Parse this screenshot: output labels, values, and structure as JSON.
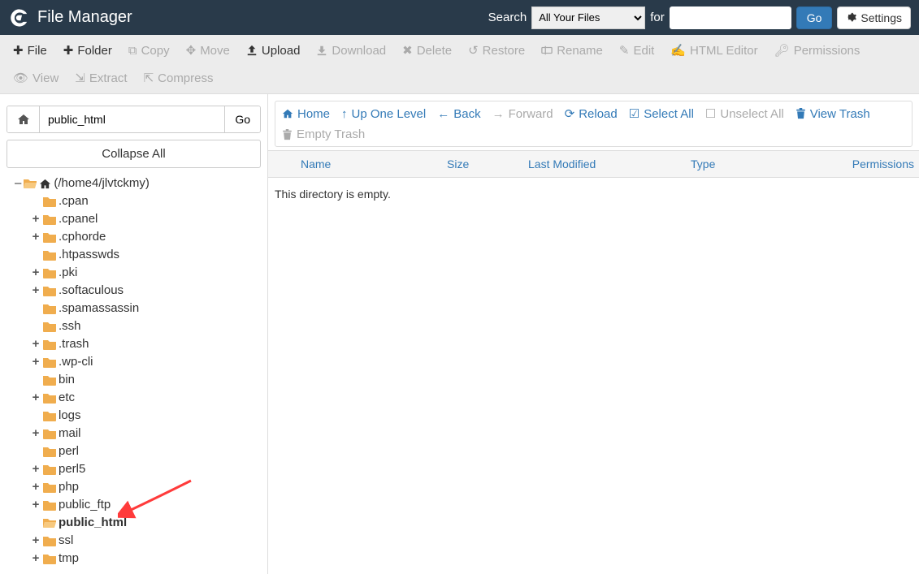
{
  "header": {
    "title": "File Manager",
    "search_label": "Search",
    "search_select_value": "All Your Files",
    "for_label": "for",
    "search_input": "",
    "go_label": "Go",
    "settings_label": "Settings"
  },
  "toolbar": {
    "file": "File",
    "folder": "Folder",
    "copy": "Copy",
    "move": "Move",
    "upload": "Upload",
    "download": "Download",
    "delete": "Delete",
    "restore": "Restore",
    "rename": "Rename",
    "edit": "Edit",
    "html_editor": "HTML Editor",
    "permissions": "Permissions",
    "view": "View",
    "extract": "Extract",
    "compress": "Compress"
  },
  "sidebar": {
    "path_value": "public_html",
    "go_label": "Go",
    "collapse_all": "Collapse All",
    "root_label": "(/home4/jlvtckmy)",
    "tree": [
      {
        "expand": false,
        "name": ".cpan"
      },
      {
        "expand": true,
        "name": ".cpanel"
      },
      {
        "expand": true,
        "name": ".cphorde"
      },
      {
        "expand": false,
        "name": ".htpasswds"
      },
      {
        "expand": true,
        "name": ".pki"
      },
      {
        "expand": true,
        "name": ".softaculous"
      },
      {
        "expand": false,
        "name": ".spamassassin"
      },
      {
        "expand": false,
        "name": ".ssh"
      },
      {
        "expand": true,
        "name": ".trash"
      },
      {
        "expand": true,
        "name": ".wp-cli"
      },
      {
        "expand": false,
        "name": "bin"
      },
      {
        "expand": true,
        "name": "etc"
      },
      {
        "expand": false,
        "name": "logs"
      },
      {
        "expand": true,
        "name": "mail"
      },
      {
        "expand": false,
        "name": "perl"
      },
      {
        "expand": true,
        "name": "perl5"
      },
      {
        "expand": true,
        "name": "php"
      },
      {
        "expand": true,
        "name": "public_ftp"
      },
      {
        "expand": false,
        "name": "public_html",
        "bold": true,
        "open": true
      },
      {
        "expand": true,
        "name": "ssl"
      },
      {
        "expand": true,
        "name": "tmp"
      }
    ]
  },
  "content_toolbar": {
    "home": "Home",
    "up": "Up One Level",
    "back": "Back",
    "forward": "Forward",
    "reload": "Reload",
    "select_all": "Select All",
    "unselect_all": "Unselect All",
    "view_trash": "View Trash",
    "empty_trash": "Empty Trash"
  },
  "grid": {
    "columns": {
      "name": "Name",
      "size": "Size",
      "modified": "Last Modified",
      "type": "Type",
      "permissions": "Permissions"
    },
    "empty_message": "This directory is empty."
  }
}
